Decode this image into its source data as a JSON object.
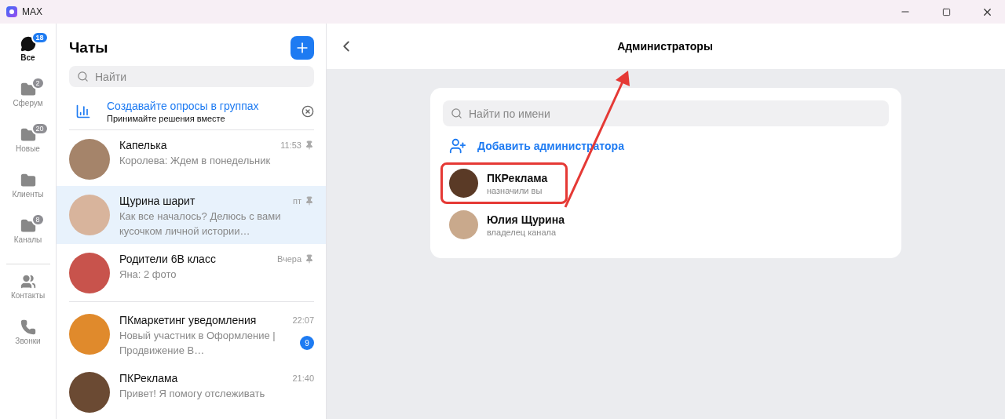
{
  "window": {
    "title": "MAX"
  },
  "rail": [
    {
      "label": "Все",
      "badge": "18",
      "selected": true
    },
    {
      "label": "Сферум",
      "badge": "2",
      "selected": false
    },
    {
      "label": "Новые",
      "badge": "20",
      "selected": false
    },
    {
      "label": "Клиенты",
      "selected": false
    },
    {
      "label": "Каналы",
      "badge": "8",
      "selected": false
    },
    {
      "label": "Контакты",
      "selected": false
    },
    {
      "label": "Звонки",
      "selected": false
    }
  ],
  "chats_panel": {
    "title": "Чаты",
    "search": {
      "placeholder": "Найти"
    },
    "promo": {
      "title": "Создавайте опросы в группах",
      "subtitle": "Принимайте решения вместе"
    },
    "chats": [
      {
        "name": "Капелька",
        "time": "11:53",
        "pinned": true,
        "preview": "Королева: Ждем в понедельник",
        "selected": false
      },
      {
        "name": "Щурина шарит",
        "time": "пт",
        "pinned": true,
        "preview": "Как все началось? Делюсь с вами кусочком личной истории…",
        "selected": true
      },
      {
        "name": "Родители 6В класс",
        "time": "Вчера",
        "pinned": true,
        "preview": "Яна: 2 фото",
        "selected": false
      },
      {
        "name": "ПКмаркетинг уведомления",
        "time": "22:07",
        "pinned": false,
        "preview": "Новый участник в Оформление | Продвижение  В…",
        "unread": "9",
        "selected": false
      },
      {
        "name": "ПКРеклама",
        "time": "21:40",
        "pinned": false,
        "preview": "Привет! Я помогу отслеживать",
        "selected": false
      }
    ]
  },
  "admins_panel": {
    "title": "Администраторы",
    "search": {
      "placeholder": "Найти по имени"
    },
    "add_label": "Добавить администратора",
    "admins": [
      {
        "name": "ПКРеклама",
        "role": "назначили вы",
        "highlighted": true
      },
      {
        "name": "Юлия Щурина",
        "role": "владелец канала",
        "highlighted": false
      }
    ]
  }
}
